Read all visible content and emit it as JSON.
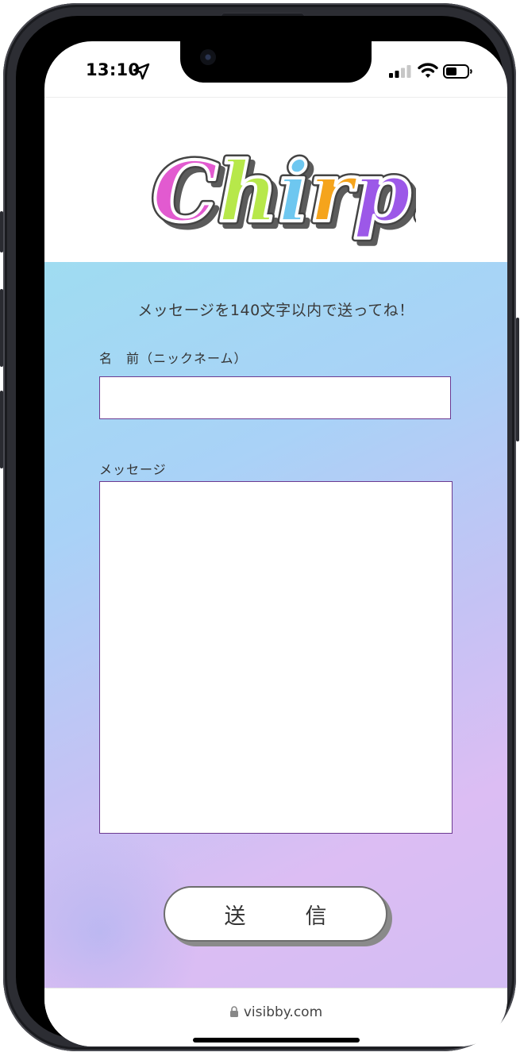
{
  "status_bar": {
    "time": "13:10",
    "icons": [
      "location-arrow-icon",
      "cellular-signal-icon",
      "wifi-icon",
      "battery-icon"
    ]
  },
  "logo": {
    "text": "Chirp!",
    "letters": [
      {
        "char": "C",
        "color": "#e25ad0"
      },
      {
        "char": "h",
        "color": "#b7e84a"
      },
      {
        "char": "i",
        "color": "#6ec7f0"
      },
      {
        "char": "r",
        "color": "#f5a41c"
      },
      {
        "char": "p",
        "color": "#9c58e8"
      },
      {
        "char": "!",
        "color": "#6ee6b4"
      }
    ]
  },
  "form": {
    "headline": "メッセージを140文字以内で送ってね！",
    "name_label": "名　前（ニックネーム）",
    "name_value": "",
    "message_label": "メッセージ",
    "message_value": "",
    "submit_label": "送　信"
  },
  "browser": {
    "url": "visibby.com"
  },
  "colors": {
    "input_border": "#6b3a91",
    "gradient_start": "#9fdcf1",
    "gradient_end": "#dcbdf3"
  }
}
